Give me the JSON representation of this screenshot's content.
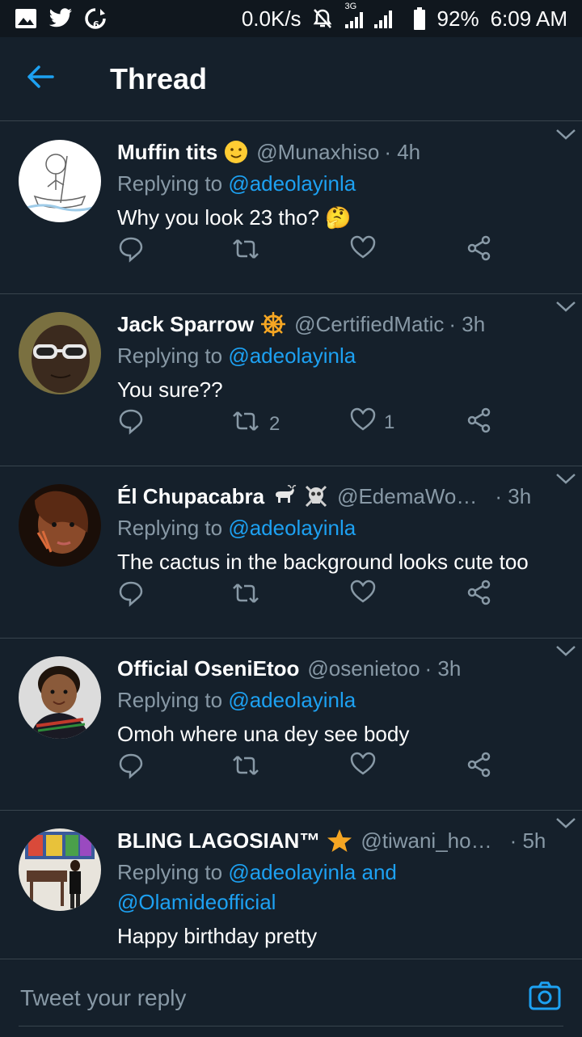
{
  "status_bar": {
    "net_speed": "0.0K/s",
    "network_label": "3G",
    "battery": "92%",
    "time": "6:09 AM",
    "icons": [
      "gallery-icon",
      "twitter-icon",
      "data-saver-icon",
      "mute-icon",
      "signal-icon",
      "battery-icon"
    ]
  },
  "header": {
    "title": "Thread",
    "back_icon": "back-arrow-icon"
  },
  "tweets": [
    {
      "name": "Muffin tits",
      "emoji": "🙂",
      "handle": "@Munaxhiso",
      "time": "· 4h",
      "replying_prefix": "Replying to ",
      "replying_to": "@adeolayinla",
      "replying_to_2": "",
      "text": "Why you look 23 tho? 🤔",
      "retweets": "",
      "likes": ""
    },
    {
      "name": "Jack Sparrow",
      "emoji": "☸",
      "handle": "@CertifiedMatic",
      "time": "· 3h",
      "replying_prefix": "Replying to ",
      "replying_to": "@adeolayinla",
      "replying_to_2": "",
      "text": "You sure??",
      "retweets": "2",
      "likes": "1"
    },
    {
      "name": "Él Chupacabra",
      "emoji": "🐐☠",
      "handle": "@EdemaWo…",
      "time": "· 3h",
      "replying_prefix": "Replying to ",
      "replying_to": "@adeolayinla",
      "replying_to_2": "",
      "text": "The cactus in the background looks cute too",
      "retweets": "",
      "likes": ""
    },
    {
      "name": "Official OseniEtoo",
      "emoji": "",
      "handle": "@osenietoo",
      "time": "· 3h",
      "replying_prefix": "Replying to ",
      "replying_to": "@adeolayinla",
      "replying_to_2": "",
      "text": "Omoh where una dey see body",
      "retweets": "",
      "likes": ""
    },
    {
      "name": "BLING LAGOSIAN™",
      "emoji": "⭐",
      "handle": "@tiwani_ho…",
      "time": "· 5h",
      "replying_prefix": "Replying to ",
      "replying_to": "@adeolayinla and",
      "replying_to_2": "@Olamideofficial",
      "text": "Happy birthday pretty",
      "retweets": "",
      "likes": ""
    }
  ],
  "composer": {
    "placeholder": "Tweet your reply",
    "icon": "camera-icon"
  },
  "colors": {
    "background": "#15202b",
    "accent": "#1da1f2",
    "muted": "#8899a6",
    "divider": "#38444d"
  }
}
